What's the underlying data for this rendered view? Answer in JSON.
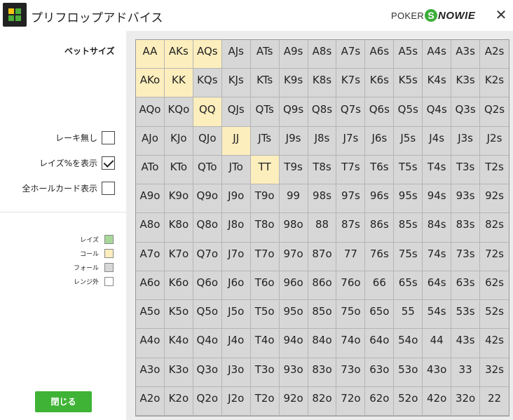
{
  "window": {
    "title": "プリフロップアドバイス",
    "brand_poker": "POKER",
    "brand_s": "S",
    "brand_nowie": "NOWIE",
    "close_glyph": "✕"
  },
  "sidebar": {
    "bet_size_label": "ベットサイズ",
    "options": [
      {
        "label": "レーキ無し",
        "checked": false
      },
      {
        "label": "レイズ%を表示",
        "checked": true
      },
      {
        "label": "全ホールカード表示",
        "checked": false
      }
    ],
    "legend": [
      {
        "label": "レイズ",
        "color": "#a7d89a"
      },
      {
        "label": "コール",
        "color": "#fdeebd"
      },
      {
        "label": "フォール",
        "color": "#d7d7d7"
      },
      {
        "label": "レンジ外",
        "color": "#ffffff"
      }
    ],
    "close_button": "閉じる"
  },
  "colors": {
    "call": "#fdeebd",
    "fold": "#d7d7d7",
    "accent_green": "#3fb335"
  },
  "hand_grid": {
    "rows": [
      [
        "AA",
        "AKs",
        "AQs",
        "AJs",
        "ATs",
        "A9s",
        "A8s",
        "A7s",
        "A6s",
        "A5s",
        "A4s",
        "A3s",
        "A2s"
      ],
      [
        "AKo",
        "KK",
        "KQs",
        "KJs",
        "KTs",
        "K9s",
        "K8s",
        "K7s",
        "K6s",
        "K5s",
        "K4s",
        "K3s",
        "K2s"
      ],
      [
        "AQo",
        "KQo",
        "QQ",
        "QJs",
        "QTs",
        "Q9s",
        "Q8s",
        "Q7s",
        "Q6s",
        "Q5s",
        "Q4s",
        "Q3s",
        "Q2s"
      ],
      [
        "AJo",
        "KJo",
        "QJo",
        "JJ",
        "JTs",
        "J9s",
        "J8s",
        "J7s",
        "J6s",
        "J5s",
        "J4s",
        "J3s",
        "J2s"
      ],
      [
        "ATo",
        "KTo",
        "QTo",
        "JTo",
        "TT",
        "T9s",
        "T8s",
        "T7s",
        "T6s",
        "T5s",
        "T4s",
        "T3s",
        "T2s"
      ],
      [
        "A9o",
        "K9o",
        "Q9o",
        "J9o",
        "T9o",
        "99",
        "98s",
        "97s",
        "96s",
        "95s",
        "94s",
        "93s",
        "92s"
      ],
      [
        "A8o",
        "K8o",
        "Q8o",
        "J8o",
        "T8o",
        "98o",
        "88",
        "87s",
        "86s",
        "85s",
        "84s",
        "83s",
        "82s"
      ],
      [
        "A7o",
        "K7o",
        "Q7o",
        "J7o",
        "T7o",
        "97o",
        "87o",
        "77",
        "76s",
        "75s",
        "74s",
        "73s",
        "72s"
      ],
      [
        "A6o",
        "K6o",
        "Q6o",
        "J6o",
        "T6o",
        "96o",
        "86o",
        "76o",
        "66",
        "65s",
        "64s",
        "63s",
        "62s"
      ],
      [
        "A5o",
        "K5o",
        "Q5o",
        "J5o",
        "T5o",
        "95o",
        "85o",
        "75o",
        "65o",
        "55",
        "54s",
        "53s",
        "52s"
      ],
      [
        "A4o",
        "K4o",
        "Q4o",
        "J4o",
        "T4o",
        "94o",
        "84o",
        "74o",
        "64o",
        "54o",
        "44",
        "43s",
        "42s"
      ],
      [
        "A3o",
        "K3o",
        "Q3o",
        "J3o",
        "T3o",
        "93o",
        "83o",
        "73o",
        "63o",
        "53o",
        "43o",
        "33",
        "32s"
      ],
      [
        "A2o",
        "K2o",
        "Q2o",
        "J2o",
        "T2o",
        "92o",
        "82o",
        "72o",
        "62o",
        "52o",
        "42o",
        "32o",
        "22"
      ]
    ],
    "call_hands": [
      "AA",
      "AKs",
      "AQs",
      "AKo",
      "KK",
      "QQ",
      "JJ",
      "TT"
    ]
  }
}
